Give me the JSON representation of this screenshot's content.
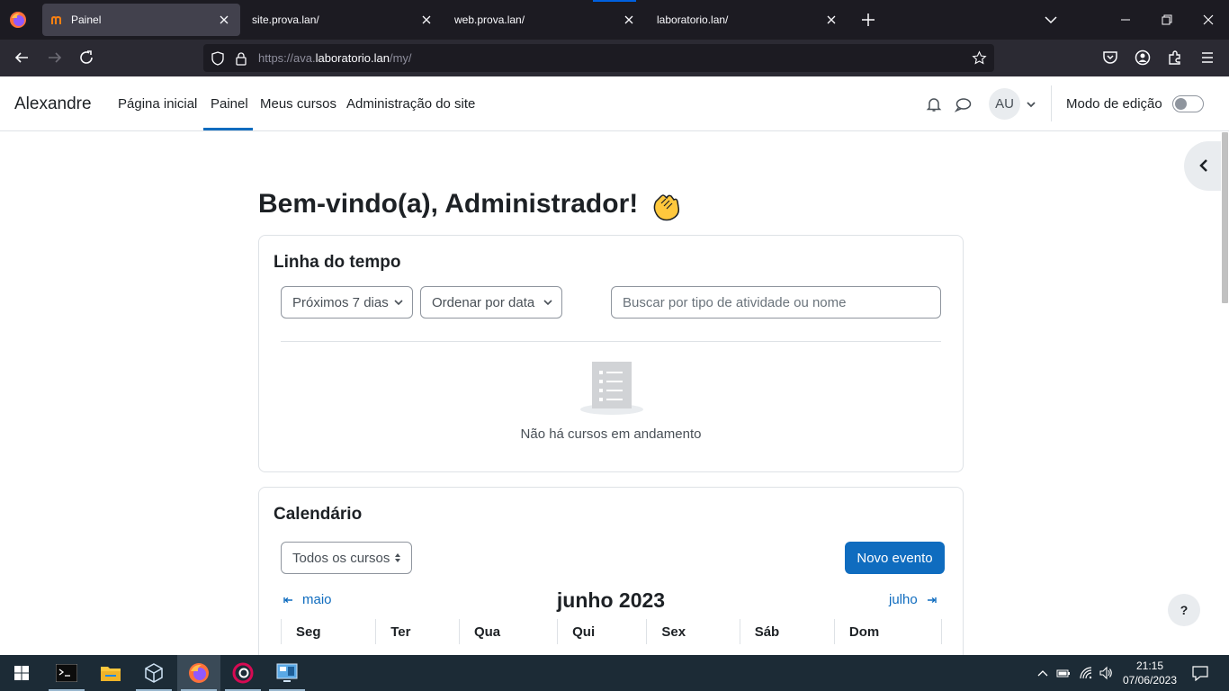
{
  "browser": {
    "tabs": [
      {
        "label": "Painel",
        "active": true
      },
      {
        "label": "site.prova.lan/",
        "active": false
      },
      {
        "label": "web.prova.lan/",
        "active": false
      },
      {
        "label": "laboratorio.lan/",
        "active": false
      }
    ],
    "url_prefix": "https://ava.",
    "url_domain": "laboratorio.lan",
    "url_path": "/my/"
  },
  "header": {
    "brand": "Alexandre",
    "nav": [
      "Página inicial",
      "Painel",
      "Meus cursos",
      "Administração do site"
    ],
    "active_nav": "Painel",
    "avatar_initials": "AU",
    "edit_mode_label": "Modo de edição",
    "edit_mode_on": false
  },
  "main": {
    "welcome": "Bem-vindo(a), Administrador!",
    "timeline": {
      "title": "Linha do tempo",
      "filter": "Próximos 7 dias",
      "sort": "Ordenar por data",
      "search_placeholder": "Buscar por tipo de atividade ou nome",
      "empty_text": "Não há cursos em andamento"
    },
    "calendar": {
      "title": "Calendário",
      "course_filter": "Todos os cursos",
      "new_event": "Novo evento",
      "prev_month": "maio",
      "current_month": "junho 2023",
      "next_month": "julho",
      "weekdays": [
        "Seg",
        "Ter",
        "Qua",
        "Qui",
        "Sex",
        "Sáb",
        "Dom"
      ]
    },
    "help": "?"
  },
  "taskbar": {
    "time": "21:15",
    "date": "07/06/2023"
  },
  "colors": {
    "accent": "#0f6cbf",
    "browser_dark": "#1c1b22",
    "taskbar": "#1c2b36"
  }
}
